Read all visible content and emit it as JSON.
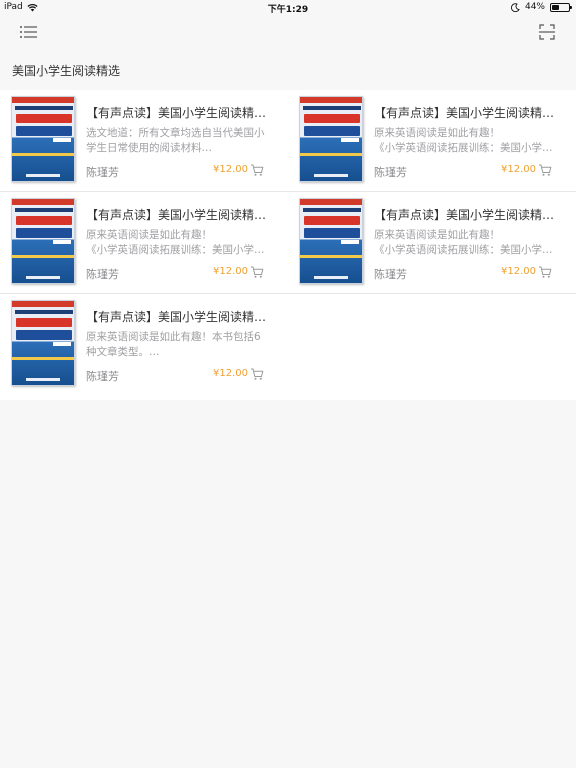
{
  "status_bar": {
    "device": "iPad",
    "time": "下午1:29",
    "battery": "44%",
    "battery_level": 0.44
  },
  "nav": {
    "left_icon": "list-menu-icon",
    "right_icon": "scan-icon"
  },
  "section": {
    "title": "美国小学生阅读精选"
  },
  "books": [
    {
      "title": "【有声点读】美国小学生阅读精选(…",
      "desc_line1": "选文地道：所有文章均选自当代美国小",
      "desc_line2": "学生日常使用的阅读材料…",
      "author": "陈瑾芳",
      "price": "¥12.00"
    },
    {
      "title": "【有声点读】美国小学生阅读精选(…",
      "desc_line1": "原来英语阅读是如此有趣！",
      "desc_line2": "《小学英语阅读拓展训练：美国小学…",
      "author": "陈瑾芳",
      "price": "¥12.00"
    },
    {
      "title": "【有声点读】美国小学生阅读精选(…",
      "desc_line1": "原来英语阅读是如此有趣！",
      "desc_line2": "《小学英语阅读拓展训练：美国小学…",
      "author": "陈瑾芳",
      "price": "¥12.00"
    },
    {
      "title": "【有声点读】美国小学生阅读精选…",
      "desc_line1": "原来英语阅读是如此有趣！",
      "desc_line2": "《小学英语阅读拓展训练：美国小学…",
      "author": "陈瑾芳",
      "price": "¥12.00"
    },
    {
      "title": "【有声点读】美国小学生阅读精选…",
      "desc_line1": "原来英语阅读是如此有趣！本书包括6",
      "desc_line2": "种文章类型。…",
      "author": "陈瑾芳",
      "price": "¥12.00"
    }
  ]
}
